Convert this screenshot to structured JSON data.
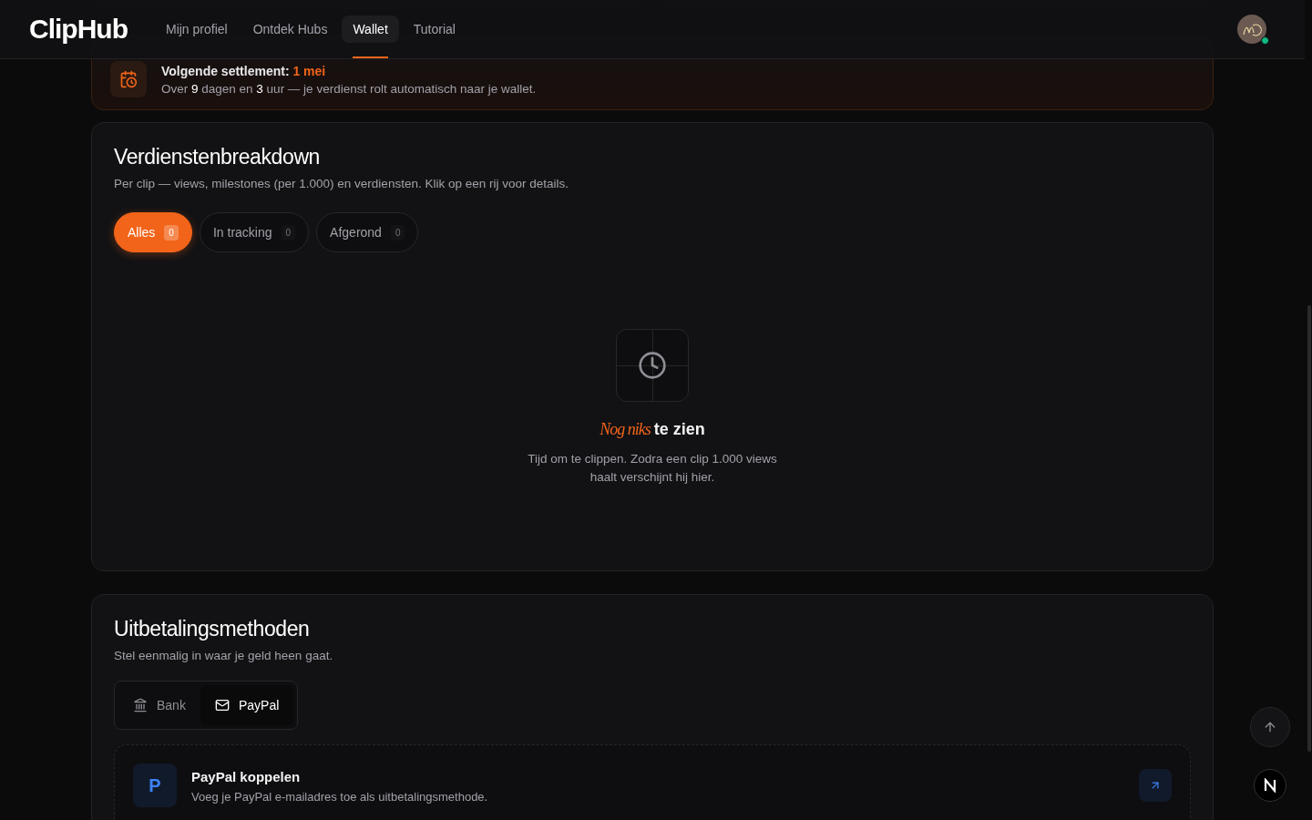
{
  "header": {
    "logo": "ClipHub",
    "nav": [
      {
        "label": "Mijn profiel",
        "selected": false
      },
      {
        "label": "Ontdek Hubs",
        "selected": false
      },
      {
        "label": "Wallet",
        "selected": true
      },
      {
        "label": "Tutorial",
        "selected": false
      }
    ],
    "avatar": {
      "online": true
    }
  },
  "settlement": {
    "title": "Volgende settlement:",
    "date": "1 mei",
    "text": "Over **9** dagen en **3** uur — je verdienst rolt automatisch naar je wallet."
  },
  "breakdown": {
    "title": "Verdienstenbreakdown",
    "subtitle": "Per clip — views, milestones (per 1.000) en verdiensten. Klik op een rij voor details.",
    "filters": [
      {
        "label": "Alles",
        "count": "0",
        "selected": true
      },
      {
        "label": "In tracking",
        "count": "0",
        "selected": false
      },
      {
        "label": "Afgerond",
        "count": "0",
        "selected": false
      }
    ],
    "empty": {
      "accent": "Nog niks",
      "title": "te zien",
      "text": "Tijd om te clippen. Zodra een clip 1.000 views haalt verschijnt hij hier."
    }
  },
  "payout": {
    "title": "Uitbetalingsmethoden",
    "subtitle": "Stel eenmalig in waar je geld heen gaat.",
    "methods": [
      {
        "kind": "bank",
        "label": "Bank",
        "selected": false
      },
      {
        "kind": "mail",
        "label": "PayPal",
        "selected": true
      }
    ],
    "connect": {
      "badge": "P",
      "title": "PayPal koppelen",
      "text": "Voeg je PayPal e-mailadres toe als uitbetalingsmethode."
    }
  }
}
